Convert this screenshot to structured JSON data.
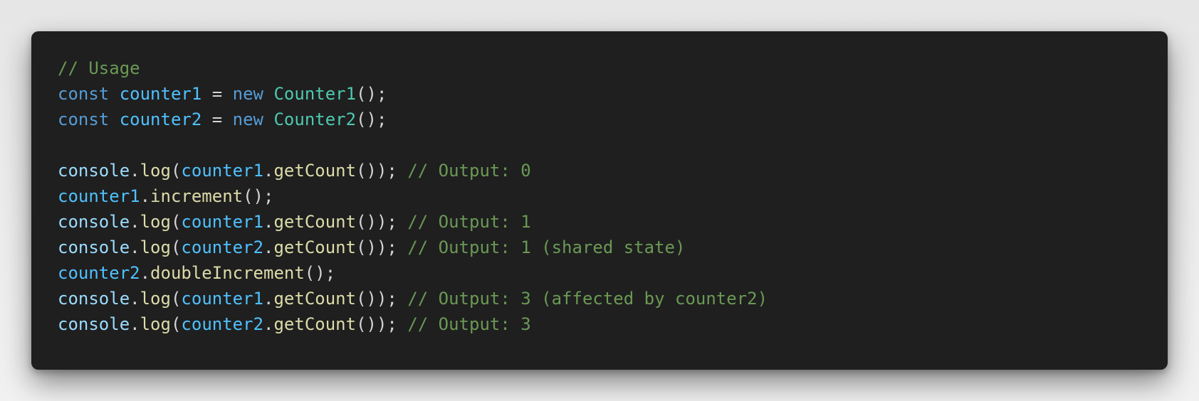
{
  "code": {
    "lines": [
      [
        {
          "t": "// Usage",
          "k": "comment"
        }
      ],
      [
        {
          "t": "const",
          "k": "keyword"
        },
        {
          "t": " ",
          "k": "punct"
        },
        {
          "t": "counter1",
          "k": "variable"
        },
        {
          "t": " = ",
          "k": "punct"
        },
        {
          "t": "new",
          "k": "keyword"
        },
        {
          "t": " ",
          "k": "punct"
        },
        {
          "t": "Counter1",
          "k": "class"
        },
        {
          "t": "();",
          "k": "punct"
        }
      ],
      [
        {
          "t": "const",
          "k": "keyword"
        },
        {
          "t": " ",
          "k": "punct"
        },
        {
          "t": "counter2",
          "k": "variable"
        },
        {
          "t": " = ",
          "k": "punct"
        },
        {
          "t": "new",
          "k": "keyword"
        },
        {
          "t": " ",
          "k": "punct"
        },
        {
          "t": "Counter2",
          "k": "class"
        },
        {
          "t": "();",
          "k": "punct"
        }
      ],
      [],
      [
        {
          "t": "console",
          "k": "object"
        },
        {
          "t": ".",
          "k": "punct"
        },
        {
          "t": "log",
          "k": "method"
        },
        {
          "t": "(",
          "k": "punct"
        },
        {
          "t": "counter1",
          "k": "variable"
        },
        {
          "t": ".",
          "k": "punct"
        },
        {
          "t": "getCount",
          "k": "method"
        },
        {
          "t": "()); ",
          "k": "punct"
        },
        {
          "t": "// Output: 0",
          "k": "comment"
        }
      ],
      [
        {
          "t": "counter1",
          "k": "variable"
        },
        {
          "t": ".",
          "k": "punct"
        },
        {
          "t": "increment",
          "k": "method"
        },
        {
          "t": "();",
          "k": "punct"
        }
      ],
      [
        {
          "t": "console",
          "k": "object"
        },
        {
          "t": ".",
          "k": "punct"
        },
        {
          "t": "log",
          "k": "method"
        },
        {
          "t": "(",
          "k": "punct"
        },
        {
          "t": "counter1",
          "k": "variable"
        },
        {
          "t": ".",
          "k": "punct"
        },
        {
          "t": "getCount",
          "k": "method"
        },
        {
          "t": "()); ",
          "k": "punct"
        },
        {
          "t": "// Output: 1",
          "k": "comment"
        }
      ],
      [
        {
          "t": "console",
          "k": "object"
        },
        {
          "t": ".",
          "k": "punct"
        },
        {
          "t": "log",
          "k": "method"
        },
        {
          "t": "(",
          "k": "punct"
        },
        {
          "t": "counter2",
          "k": "variable"
        },
        {
          "t": ".",
          "k": "punct"
        },
        {
          "t": "getCount",
          "k": "method"
        },
        {
          "t": "()); ",
          "k": "punct"
        },
        {
          "t": "// Output: 1 (shared state)",
          "k": "comment"
        }
      ],
      [
        {
          "t": "counter2",
          "k": "variable"
        },
        {
          "t": ".",
          "k": "punct"
        },
        {
          "t": "doubleIncrement",
          "k": "method"
        },
        {
          "t": "();",
          "k": "punct"
        }
      ],
      [
        {
          "t": "console",
          "k": "object"
        },
        {
          "t": ".",
          "k": "punct"
        },
        {
          "t": "log",
          "k": "method"
        },
        {
          "t": "(",
          "k": "punct"
        },
        {
          "t": "counter1",
          "k": "variable"
        },
        {
          "t": ".",
          "k": "punct"
        },
        {
          "t": "getCount",
          "k": "method"
        },
        {
          "t": "()); ",
          "k": "punct"
        },
        {
          "t": "// Output: 3 (affected by counter2)",
          "k": "comment"
        }
      ],
      [
        {
          "t": "console",
          "k": "object"
        },
        {
          "t": ".",
          "k": "punct"
        },
        {
          "t": "log",
          "k": "method"
        },
        {
          "t": "(",
          "k": "punct"
        },
        {
          "t": "counter2",
          "k": "variable"
        },
        {
          "t": ".",
          "k": "punct"
        },
        {
          "t": "getCount",
          "k": "method"
        },
        {
          "t": "()); ",
          "k": "punct"
        },
        {
          "t": "// Output: 3",
          "k": "comment"
        }
      ]
    ]
  },
  "colors": {
    "page_background": "#ececec",
    "editor_background": "#1f1f1f",
    "comment": "#6a9955",
    "keyword": "#569cd6",
    "variable": "#4fc1ff",
    "class": "#4ec9b0",
    "method": "#dcdcaa",
    "object": "#9cdcfe",
    "punct": "#d4d4d4"
  }
}
